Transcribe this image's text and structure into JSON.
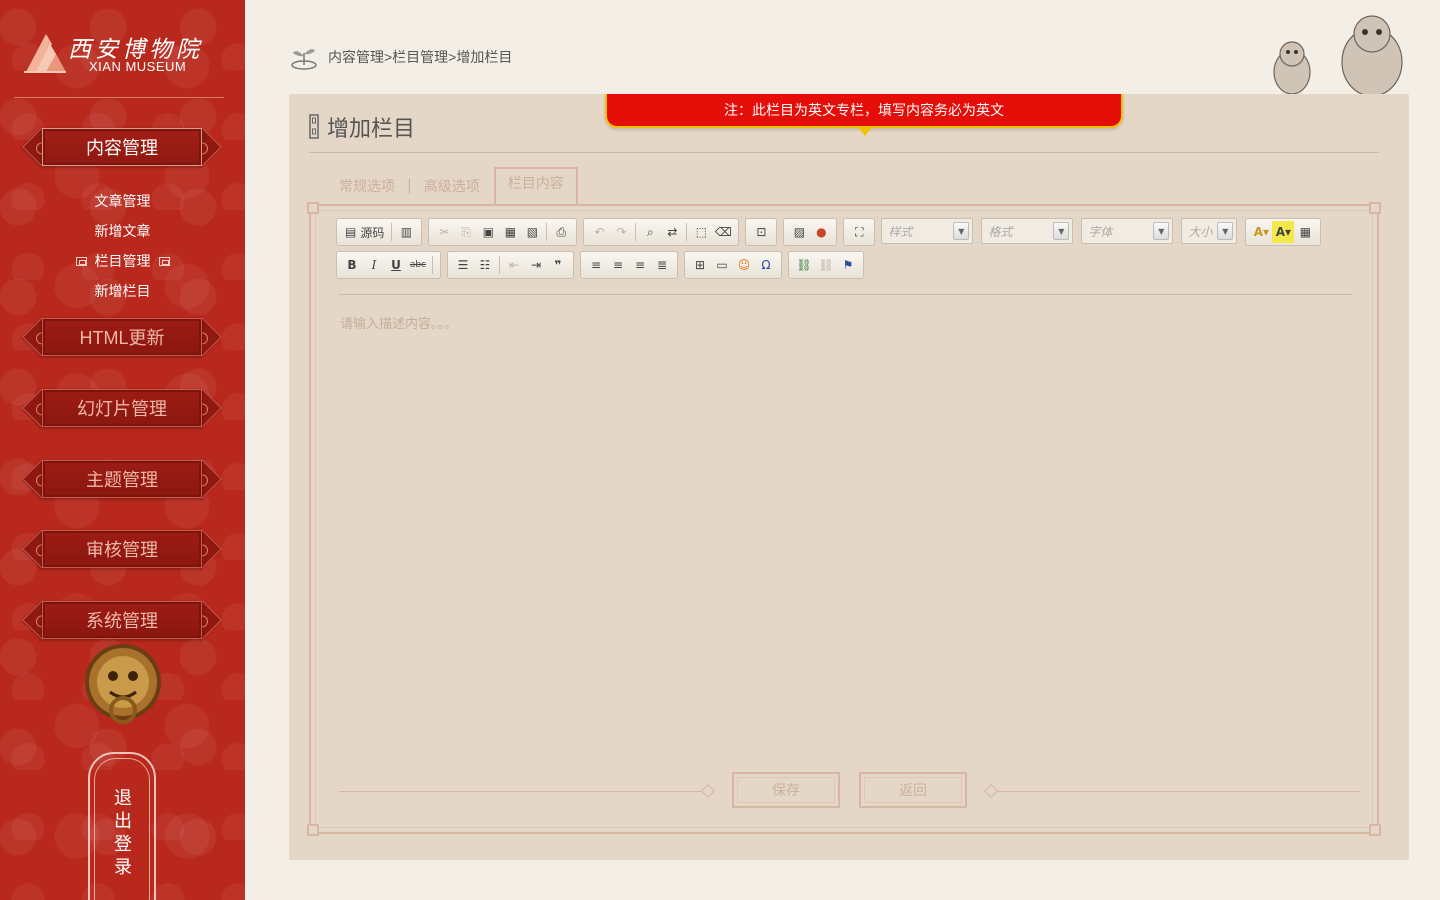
{
  "sidebar": {
    "logo_cn": "西安博物院",
    "logo_en": "XIAN MUSEUM",
    "menu": [
      {
        "label": "内容管理"
      },
      {
        "label": "HTML更新"
      },
      {
        "label": "幻灯片管理"
      },
      {
        "label": "主题管理"
      },
      {
        "label": "审核管理"
      },
      {
        "label": "系统管理"
      }
    ],
    "submenu": [
      {
        "label": "文章管理"
      },
      {
        "label": "新增文章"
      },
      {
        "label": "栏目管理"
      },
      {
        "label": "新增栏目"
      }
    ],
    "logout": "退出登录",
    "colors": {
      "background": "#b8281c",
      "plate": "#8f1911"
    }
  },
  "header": {
    "breadcrumb": "内容管理>栏目管理>增加栏目",
    "icon": "sprout-icon"
  },
  "notice": {
    "text": "注：此栏目为英文专栏，填写内容务必为英文",
    "color": "#e50d08"
  },
  "panel": {
    "title": "增加栏目",
    "tabs": [
      {
        "label": "常规选项"
      },
      {
        "label": "高级选项"
      },
      {
        "label": "栏目内容"
      }
    ],
    "tab_separator": "|",
    "editor": {
      "source_label": "源码",
      "combos": [
        {
          "placeholder": "样式"
        },
        {
          "placeholder": "格式"
        },
        {
          "placeholder": "字体"
        },
        {
          "placeholder": "大小"
        }
      ],
      "placeholder": "请输入描述内容。。。"
    },
    "buttons": {
      "save": "保存",
      "back": "返回"
    }
  }
}
